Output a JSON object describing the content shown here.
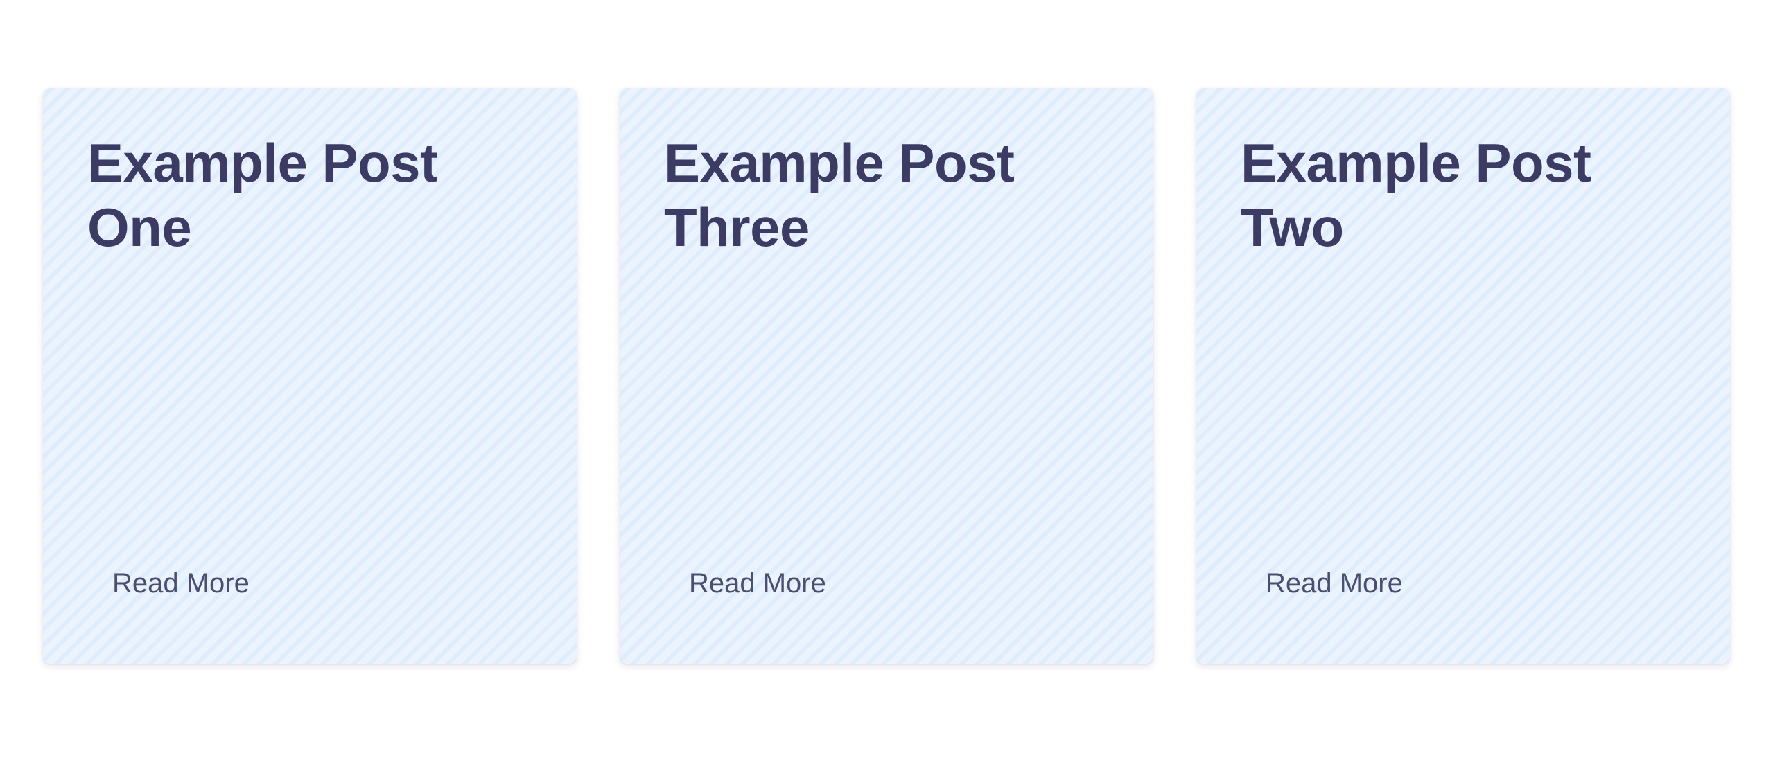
{
  "posts": [
    {
      "title": "Example Post One",
      "link_label": "Read More"
    },
    {
      "title": "Example Post Three",
      "link_label": "Read More"
    },
    {
      "title": "Example Post Two",
      "link_label": "Read More"
    }
  ],
  "colors": {
    "card_background": "#eaf3fe",
    "card_stripe": "#d6e6fa",
    "title_text": "#3b3b63",
    "link_text": "#4b4e6d",
    "page_background": "#ffffff"
  }
}
